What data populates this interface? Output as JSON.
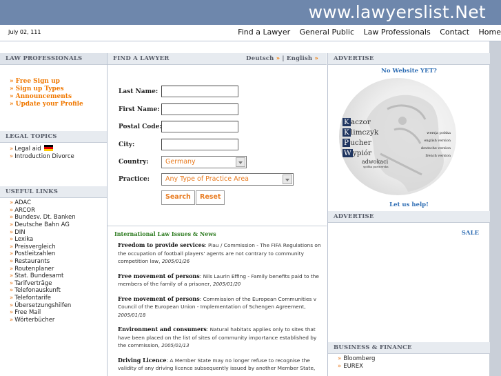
{
  "header": {
    "site": "www.lawyerslist.Net",
    "date": "July 02, 111"
  },
  "nav": [
    "Find a Lawyer",
    "General Public",
    "Law Professionals",
    "Contact",
    "Home"
  ],
  "left": {
    "law_professionals": {
      "title": "LAW PROFESSIONALS",
      "items": [
        "Free Sign up",
        "Sign up Types",
        "Announcements",
        "Update your Profile"
      ]
    },
    "legal_topics": {
      "title": "LEGAL TOPICS",
      "items": [
        "Legal aid",
        "Introduction Divorce"
      ]
    },
    "useful_links": {
      "title": "USEFUL  LINKS",
      "items": [
        "ADAC",
        "ARCOR",
        "Bundesv. Dt. Banken",
        "Deutsche Bahn AG",
        "DIN",
        "Lexika",
        "Preisvergleich",
        "Postleitzahlen",
        "Restaurants",
        "Routenplaner",
        "Stat. Bundesamt",
        "Tarifverträge",
        "Telefonauskunft",
        "Telefontarife",
        "Übersetzungshilfen",
        "Free Mail",
        "Wörterbücher"
      ]
    }
  },
  "center": {
    "title": "FIND A LAWYER",
    "lang": {
      "de": "Deutsch",
      "sep": "|",
      "en": "English"
    },
    "form": {
      "last_name": "Last Name:",
      "first_name": "First Name:",
      "postal_code": "Postal Code:",
      "city": "City:",
      "country": "Country:",
      "country_value": "Germany",
      "practice": "Practice:",
      "practice_value": "Any Type of Practice Area",
      "search": "Search",
      "reset": "Reset"
    },
    "news": {
      "title": "International Law Issues & News",
      "items": [
        {
          "head": "Freedom to provide services",
          "text": ": Piau / Commission - The FIFA Regulations on the occupation of football players' agents are not contrary to community competition law, ",
          "date": "2005/01/26"
        },
        {
          "head": "Free movement of persons",
          "text": ": Nils Laurin Effing - Family benefits paid to the members of the family of a prisoner, ",
          "date": "2005/01/20"
        },
        {
          "head": "Free movement of persons",
          "text": ": Commission of the European Communities v Council of the European Union - Implementation of Schengen Agreement, ",
          "date": "2005/01/18"
        },
        {
          "head": "Environment and consumers",
          "text": ": Natural habitats applies only to sites that have been placed on the list of sites of community importance established by the commission, ",
          "date": "2005/01/13"
        },
        {
          "head": "Driving Licence",
          "text": ": A Member State may no longer refuse to recognise the validity of any driving licence subsequently issued by another Member State, ",
          "date": ""
        }
      ]
    }
  },
  "right": {
    "advertise1": "ADVERTISE",
    "no_website": "No Website YET?",
    "ad_names": [
      "aczor",
      "limczyk",
      "ucher",
      "ypiór"
    ],
    "ad_initials": [
      "K",
      "K",
      "P",
      "W"
    ],
    "ad_sub": "adwokaci",
    "ad_sub2": "spółka partnerska",
    "ad_versions": [
      "wersja polska",
      "english version",
      "deutsche version",
      "french version"
    ],
    "let_us_help": "Let us help!",
    "advertise2": "ADVERTISE",
    "sale": "SALE",
    "business": {
      "title": "BUSINESS & FINANCE",
      "items": [
        "Bloomberg",
        "EUREX"
      ]
    }
  },
  "colors": {
    "header": "#6e87ac",
    "orange": "#f07800",
    "link_blue": "#2d6cb3",
    "news_green": "#2b7a1e"
  }
}
